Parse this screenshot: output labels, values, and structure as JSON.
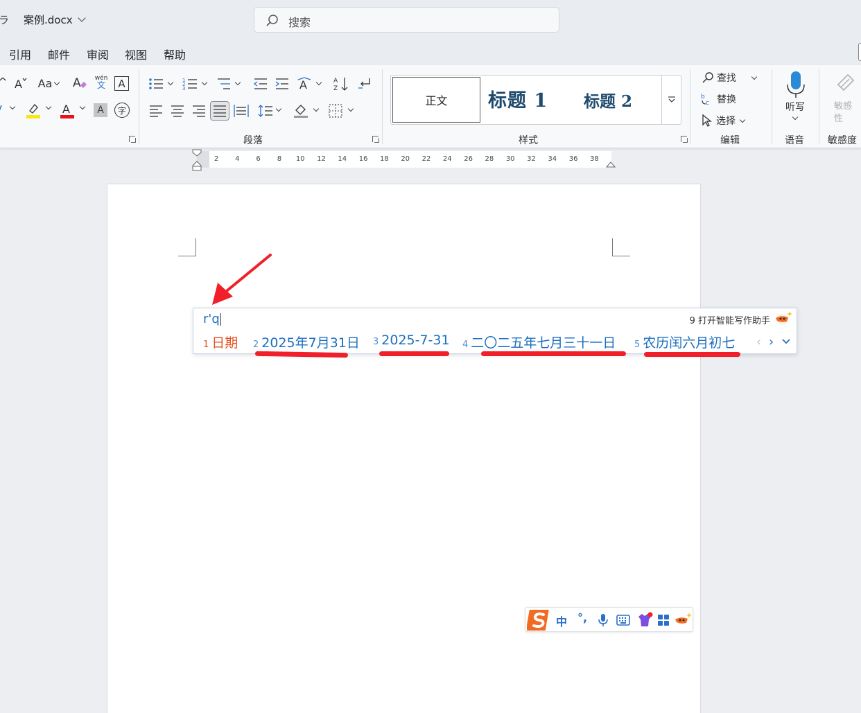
{
  "titlebar": {
    "left_fragment": "ラ",
    "doc_title": "案例.docx",
    "search_placeholder": "搜索"
  },
  "menu": {
    "items": [
      "引用",
      "邮件",
      "审阅",
      "视图",
      "帮助"
    ]
  },
  "ribbon": {
    "paragraph_group_label": "段落",
    "styles_group_label": "样式",
    "edit_group_label": "编辑",
    "voice_group_label": "语音",
    "sensitivity_group_label": "敏感度",
    "styles": {
      "normal": "正文",
      "heading1": "标题 1",
      "heading2": "标题 2"
    },
    "edit": {
      "find": "查找",
      "replace": "替换",
      "select": "选择"
    },
    "voice": {
      "dictate": "听写"
    },
    "sensitivity": {
      "label_line1": "敏感",
      "label_line2": "性"
    },
    "font_case_label": "Aa",
    "phonetic_label": "wén",
    "phonetic_char": "文",
    "char_border_label": "A",
    "char_shade_label": "A",
    "enclose_label": "字"
  },
  "ruler": {
    "ticks": [
      "2",
      "4",
      "6",
      "8",
      "10",
      "12",
      "14",
      "16",
      "18",
      "20",
      "22",
      "24",
      "26",
      "28",
      "30",
      "32",
      "34",
      "36",
      "38"
    ]
  },
  "ime": {
    "input": "r'q",
    "assist_num": "9",
    "assist_label": "打开智能写作助手",
    "candidates": [
      {
        "num": "1",
        "text": "日期"
      },
      {
        "num": "2",
        "text": "2025年7月31日"
      },
      {
        "num": "3",
        "text": "2025-7-31"
      },
      {
        "num": "4",
        "text": "二〇二五年七月三十一日"
      },
      {
        "num": "5",
        "text": "农历闰六月初七"
      }
    ],
    "prev": "‹",
    "next": "›",
    "expand": "⌄"
  },
  "sogou_bar": {
    "lang": "中",
    "punct": "°,"
  },
  "colors": {
    "accent_blue": "#1c6fc0",
    "first_candidate": "#e6501f",
    "annotation_red": "#f01f2a",
    "sogou_orange": "#f26b22"
  }
}
